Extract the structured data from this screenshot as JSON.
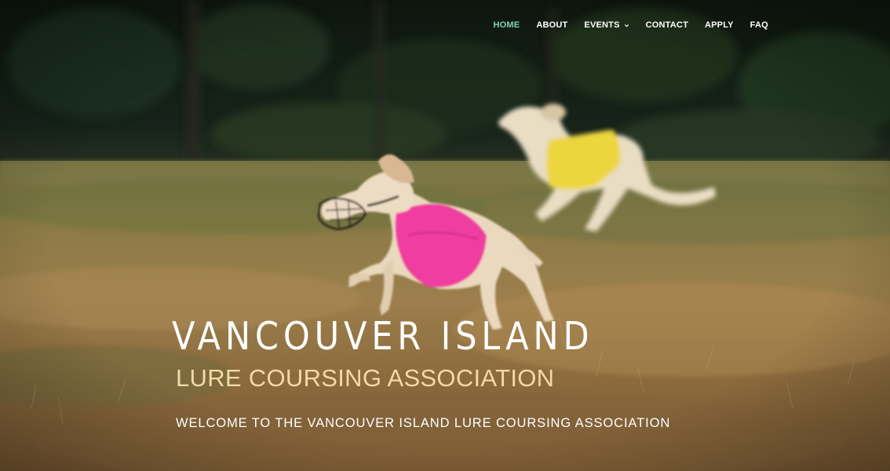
{
  "nav": {
    "items": [
      {
        "label": "HOME",
        "active": true
      },
      {
        "label": "ABOUT",
        "active": false
      },
      {
        "label": "EVENTS",
        "active": false,
        "has_dropdown": true
      },
      {
        "label": "CONTACT",
        "active": false
      },
      {
        "label": "APPLY",
        "active": false
      },
      {
        "label": "FAQ",
        "active": false
      }
    ],
    "active_color": "#7fd3b3",
    "color": "#ffffff"
  },
  "hero": {
    "title": "VANCOUVER ISLAND",
    "subtitle": "LURE COURSING ASSOCIATION",
    "welcome": "WELCOME TO THE VANCOUVER ISLAND LURE COURSING ASSOCIATION",
    "subtitle_color": "#f3d9a6",
    "image_description_icon": "running-dogs-photo"
  }
}
